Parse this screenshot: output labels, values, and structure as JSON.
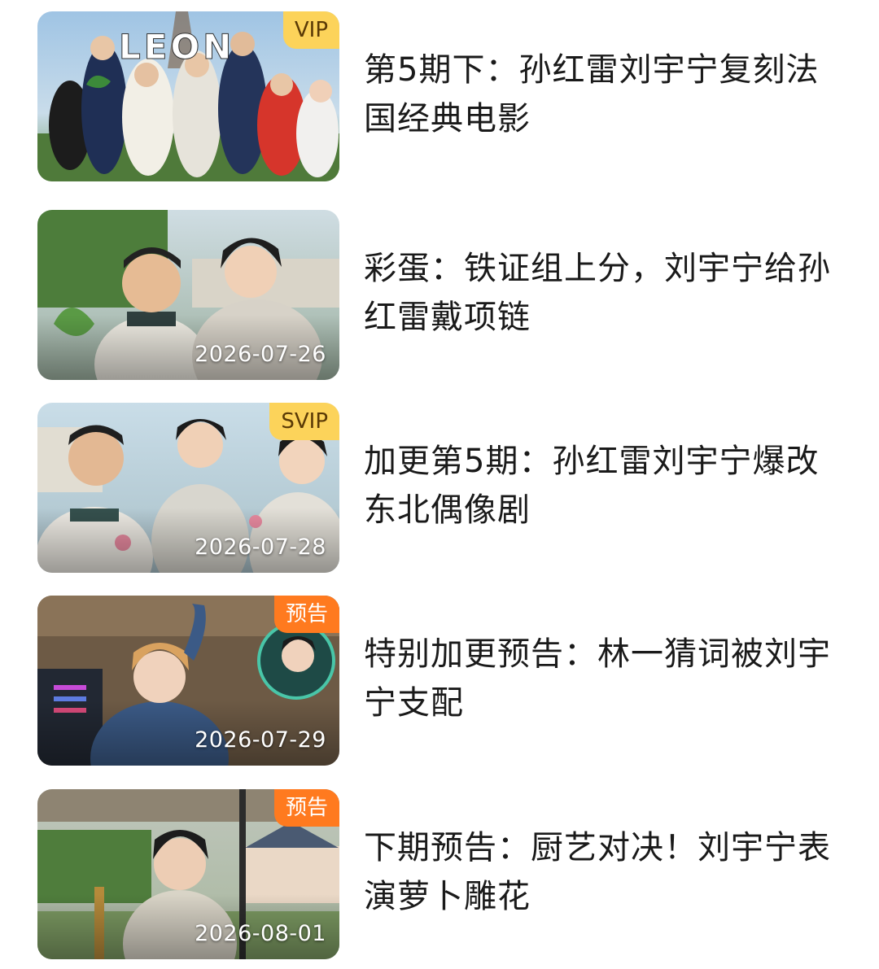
{
  "videos": [
    {
      "title": "第5期下：孙红雷刘宇宁复刻法国经典电影",
      "badge": "VIP",
      "date": ""
    },
    {
      "title": "彩蛋：铁证组上分，刘宇宁给孙红雷戴项链",
      "badge": "",
      "date": "2026-07-26"
    },
    {
      "title": "加更第5期：孙红雷刘宇宁爆改东北偶像剧",
      "badge": "SVIP",
      "date": "2026-07-28"
    },
    {
      "title": "特别加更预告：林一猜词被刘宇宁支配",
      "badge": "预告",
      "date": "2026-07-29"
    },
    {
      "title": "下期预告：厨艺对决！刘宇宁表演萝卜雕花",
      "badge": "预告",
      "date": "2026-08-01"
    }
  ],
  "thumbnails": [
    {
      "logo_text": "LEON"
    }
  ],
  "colors": {
    "vip_badge": "#fcd35a",
    "trailer_badge": "#ff7a1f",
    "title_text": "#1a1a1a"
  }
}
